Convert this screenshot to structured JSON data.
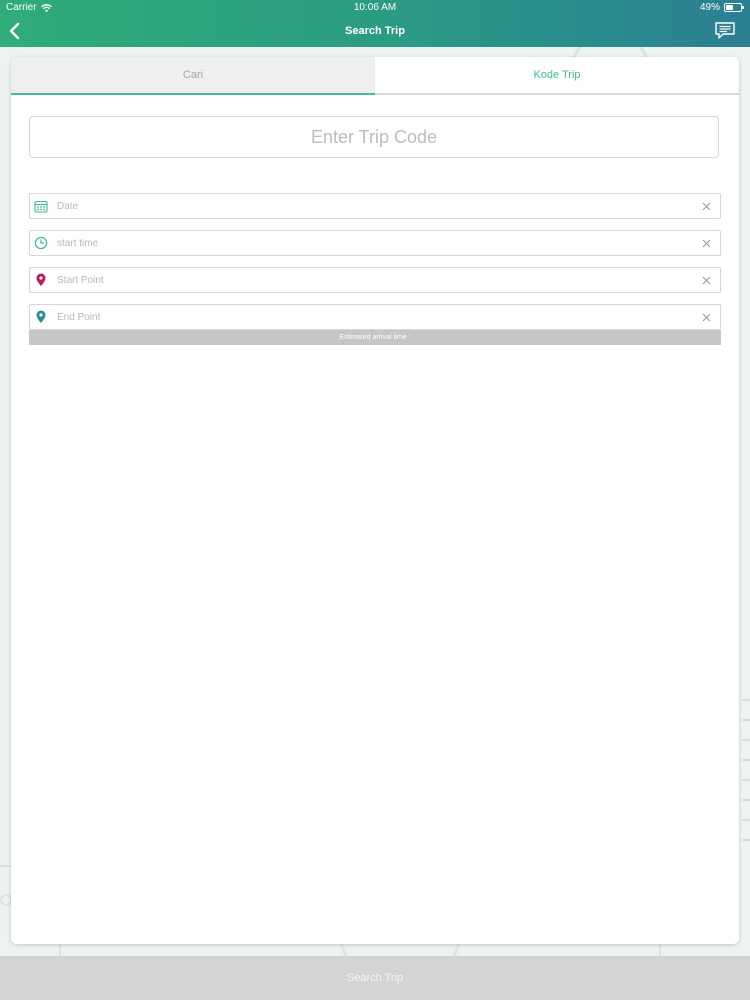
{
  "status_bar": {
    "carrier": "Carrier",
    "time": "10:06 AM",
    "battery": "49%",
    "battery_level": 0.49
  },
  "nav": {
    "title": "Search Trip",
    "back_icon": "chevron-left-icon",
    "chat_icon": "chat-bubble-icon"
  },
  "tabs": [
    {
      "label": "Cari",
      "active": false
    },
    {
      "label": "Kode Trip",
      "active": true
    }
  ],
  "trip_code": {
    "placeholder": "Enter Trip Code"
  },
  "fields": [
    {
      "placeholder": "Date",
      "icon": "calendar-icon",
      "icon_color": "#3fbd8c"
    },
    {
      "placeholder": "start time",
      "icon": "clock-icon",
      "icon_color": "#3fbd8c"
    },
    {
      "placeholder": "Start Point",
      "icon": "map-pin-icon",
      "icon_color": "#c0175b"
    },
    {
      "placeholder": "End Point",
      "icon": "map-pin-icon",
      "icon_color": "#2c8f8d"
    }
  ],
  "eta": {
    "label": "Estimated arrival time :"
  },
  "footer": {
    "button_label": "Search Trip"
  },
  "colors": {
    "accent": "#3fbd8c",
    "header_start": "#2fad77",
    "header_end": "#2b7f92",
    "footer_bg": "#d4d4d4"
  }
}
